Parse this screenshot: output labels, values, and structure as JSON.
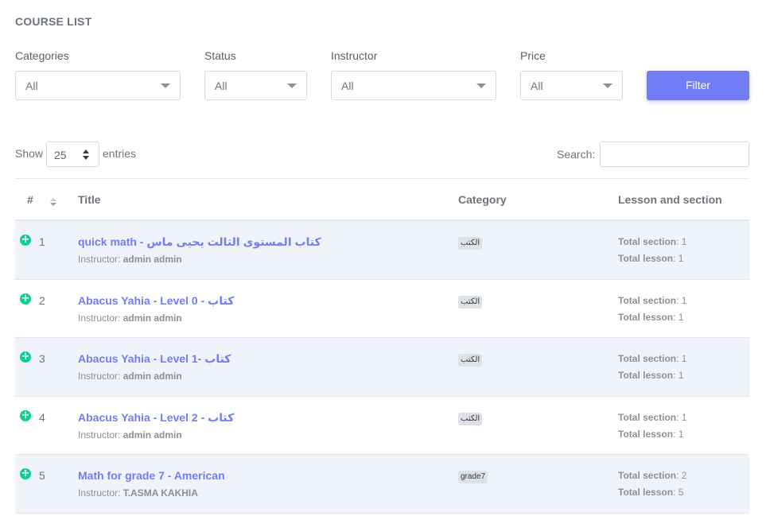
{
  "page_title": "COURSE LIST",
  "filters": {
    "categories": {
      "label": "Categories",
      "value": "All"
    },
    "status": {
      "label": "Status",
      "value": "All"
    },
    "instructor": {
      "label": "Instructor",
      "value": "All"
    },
    "price": {
      "label": "Price",
      "value": "All"
    },
    "filter_button": "Filter",
    "accent_color": "#727cf5"
  },
  "table_controls": {
    "show_label": "Show",
    "page_length": "25",
    "entries_label": "entries",
    "search_label": "Search:",
    "search_value": ""
  },
  "table": {
    "headers": {
      "num": "#",
      "title": "Title",
      "category": "Category",
      "lesson": "Lesson and section"
    },
    "instructor_prefix": "Instructor:",
    "section_prefix": "Total section",
    "lesson_prefix": "Total lesson",
    "rows": [
      {
        "num": "1",
        "title": "quick math - كتاب المستوى الثالث يحيى ماس",
        "instructor": "admin admin",
        "category": "الكتب",
        "sections": "1",
        "lessons": "1"
      },
      {
        "num": "2",
        "title": "Abacus Yahia - Level 0 - كتاب",
        "instructor": "admin admin",
        "category": "الكتب",
        "sections": "1",
        "lessons": "1"
      },
      {
        "num": "3",
        "title": "Abacus Yahia - Level 1- كتاب",
        "instructor": "admin admin",
        "category": "الكتب",
        "sections": "1",
        "lessons": "1"
      },
      {
        "num": "4",
        "title": "Abacus Yahia - Level 2 - كتاب",
        "instructor": "admin admin",
        "category": "الكتب",
        "sections": "1",
        "lessons": "1"
      },
      {
        "num": "5",
        "title": "Math for grade 7 - American",
        "instructor": "T.ASMA KAKHIA",
        "category": "grade7",
        "sections": "2",
        "lessons": "5"
      }
    ],
    "row_expand_icon": "plus-circle-icon",
    "expand_icon_color": "#0acf97",
    "striped_row_color": "#f1f3fa"
  }
}
